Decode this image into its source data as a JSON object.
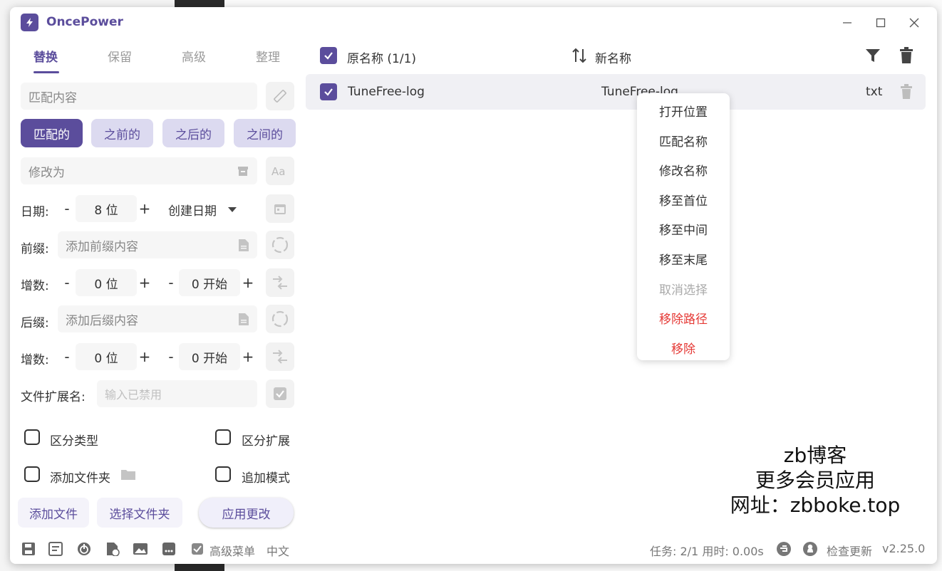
{
  "window": {
    "title": "OncePower"
  },
  "tabs": [
    {
      "label": "替换"
    },
    {
      "label": "保留"
    },
    {
      "label": "高级"
    },
    {
      "label": "整理"
    }
  ],
  "replace": {
    "match_placeholder": "匹配内容",
    "modes": [
      "匹配的",
      "之前的",
      "之后的",
      "之间的"
    ],
    "modify_placeholder": "修改为"
  },
  "date": {
    "label": "日期:",
    "minus": "-",
    "value": "8 位",
    "plus": "+",
    "type": "创建日期"
  },
  "prefix": {
    "label": "前缀:",
    "placeholder": "添加前缀内容"
  },
  "increment1": {
    "label": "增数:",
    "minus": "-",
    "digits": "0 位",
    "plus": "+",
    "minus2": "-",
    "start": "0 开始",
    "plus2": "+"
  },
  "suffix": {
    "label": "后缀:",
    "placeholder": "添加后缀内容"
  },
  "increment2": {
    "label": "增数:",
    "minus": "-",
    "digits": "0 位",
    "plus": "+",
    "minus2": "-",
    "start": "0 开始",
    "plus2": "+"
  },
  "extension": {
    "label": "文件扩展名:",
    "placeholder": "输入已禁用"
  },
  "options": {
    "distinguish_type": "区分类型",
    "distinguish_ext": "区分扩展",
    "add_folder": "添加文件夹",
    "append_mode": "追加模式"
  },
  "buttons": {
    "add_file": "添加文件",
    "select_folder": "选择文件夹",
    "apply": "应用更改"
  },
  "footer": {
    "advanced_menu": "高级菜单",
    "language": "中文",
    "task_stats": "任务: 2/1 用时: 0.00s",
    "check_update": "检查更新",
    "version": "v2.25.0"
  },
  "list": {
    "orig_header": "原名称 (1/1)",
    "new_header": "新名称",
    "rows": [
      {
        "orig": "TuneFree-log",
        "new": "TuneFree-log",
        "ext": "txt"
      }
    ]
  },
  "context_menu": [
    {
      "label": "打开位置"
    },
    {
      "label": "匹配名称"
    },
    {
      "label": "修改名称"
    },
    {
      "label": "移至首位"
    },
    {
      "label": "移至中间"
    },
    {
      "label": "移至末尾"
    },
    {
      "label": "取消选择"
    },
    {
      "label": "移除路径"
    },
    {
      "label": "移除"
    }
  ],
  "watermark": {
    "line1": "zb博客",
    "line2": "更多会员应用",
    "line3": "网址：zbboke.top"
  },
  "colors": {
    "accent": "#5b4d9c",
    "danger": "#e53935"
  }
}
